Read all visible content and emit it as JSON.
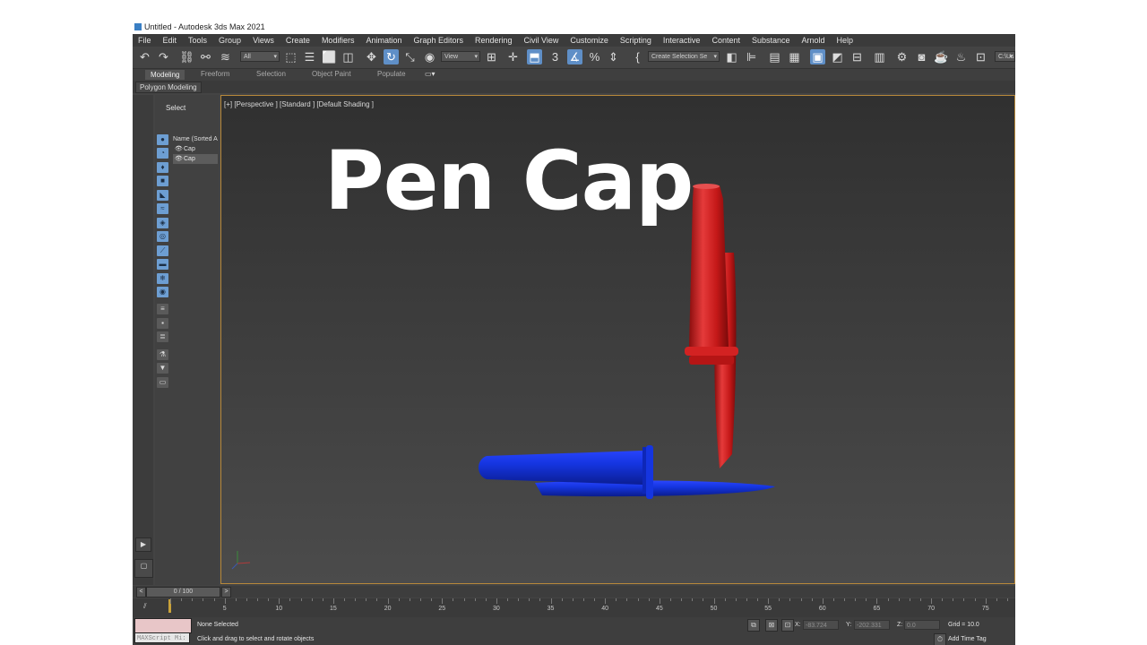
{
  "window": {
    "title": "Untitled - Autodesk 3ds Max 2021"
  },
  "menu": [
    "File",
    "Edit",
    "Tools",
    "Group",
    "Views",
    "Create",
    "Modifiers",
    "Animation",
    "Graph Editors",
    "Rendering",
    "Civil View",
    "Customize",
    "Scripting",
    "Interactive",
    "Content",
    "Substance",
    "Arnold",
    "Help"
  ],
  "toolbar": {
    "filter_dropdown": "All",
    "ref_coord_dropdown": "View",
    "selection_set_dropdown": "Create Selection Se",
    "path_label": "C:\\Us",
    "icons": [
      "undo-icon",
      "redo-icon",
      "link-icon",
      "unlink-icon",
      "bind-spacewarp-icon",
      "select-object-icon",
      "select-by-name-icon",
      "rect-region-icon",
      "window-crossing-icon",
      "move-icon",
      "rotate-icon",
      "scale-icon",
      "placement-icon",
      "pivot-icon",
      "snap-toggle-icon",
      "angle-snap-icon",
      "percent-snap-icon",
      "spinner-snap-icon",
      "edit-named-sets-icon",
      "mirror-icon",
      "align-icon",
      "layer-explorer-icon",
      "ribbon-toggle-icon",
      "curve-editor-icon",
      "schematic-icon",
      "material-editor-icon",
      "render-setup-icon",
      "render-frame-icon",
      "render-icon",
      "teapot-icon"
    ]
  },
  "ribbon": {
    "tabs": [
      "Modeling",
      "Freeform",
      "Selection",
      "Object Paint",
      "Populate"
    ],
    "active_tab": "Modeling",
    "panel": "Polygon Modeling"
  },
  "scene_explorer": {
    "title": "Select",
    "column_header": "Name (Sorted A",
    "items": [
      "Cap",
      "Cap"
    ]
  },
  "viewport": {
    "label": "[+] [Perspective ] [Standard ] [Default Shading ]",
    "overlay_title": "Pen Cap",
    "objects": [
      {
        "name": "red-pen-cap",
        "color": "#d21e1e"
      },
      {
        "name": "blue-pen-cap",
        "color": "#1535e0"
      }
    ]
  },
  "timeline": {
    "slider": "0 / 100",
    "ticks": [
      "5",
      "10",
      "15",
      "20",
      "25",
      "30",
      "35",
      "40",
      "45",
      "50",
      "55",
      "60",
      "65",
      "70",
      "75"
    ]
  },
  "status": {
    "maxscript_label": "MAXScript Mi:",
    "selection": "None Selected",
    "prompt": "Click and drag to select and rotate objects",
    "x_label": "X:",
    "x_value": "-83.724",
    "y_label": "Y:",
    "y_value": "-202.331",
    "z_label": "Z:",
    "z_value": "0.0",
    "grid": "Grid = 10.0",
    "time_tag": "Add Time Tag"
  },
  "colors": {
    "accent": "#5f8fc7",
    "viewport_border": "#b8893a",
    "red_cap": "#d21e1e",
    "blue_cap": "#1535e0"
  }
}
